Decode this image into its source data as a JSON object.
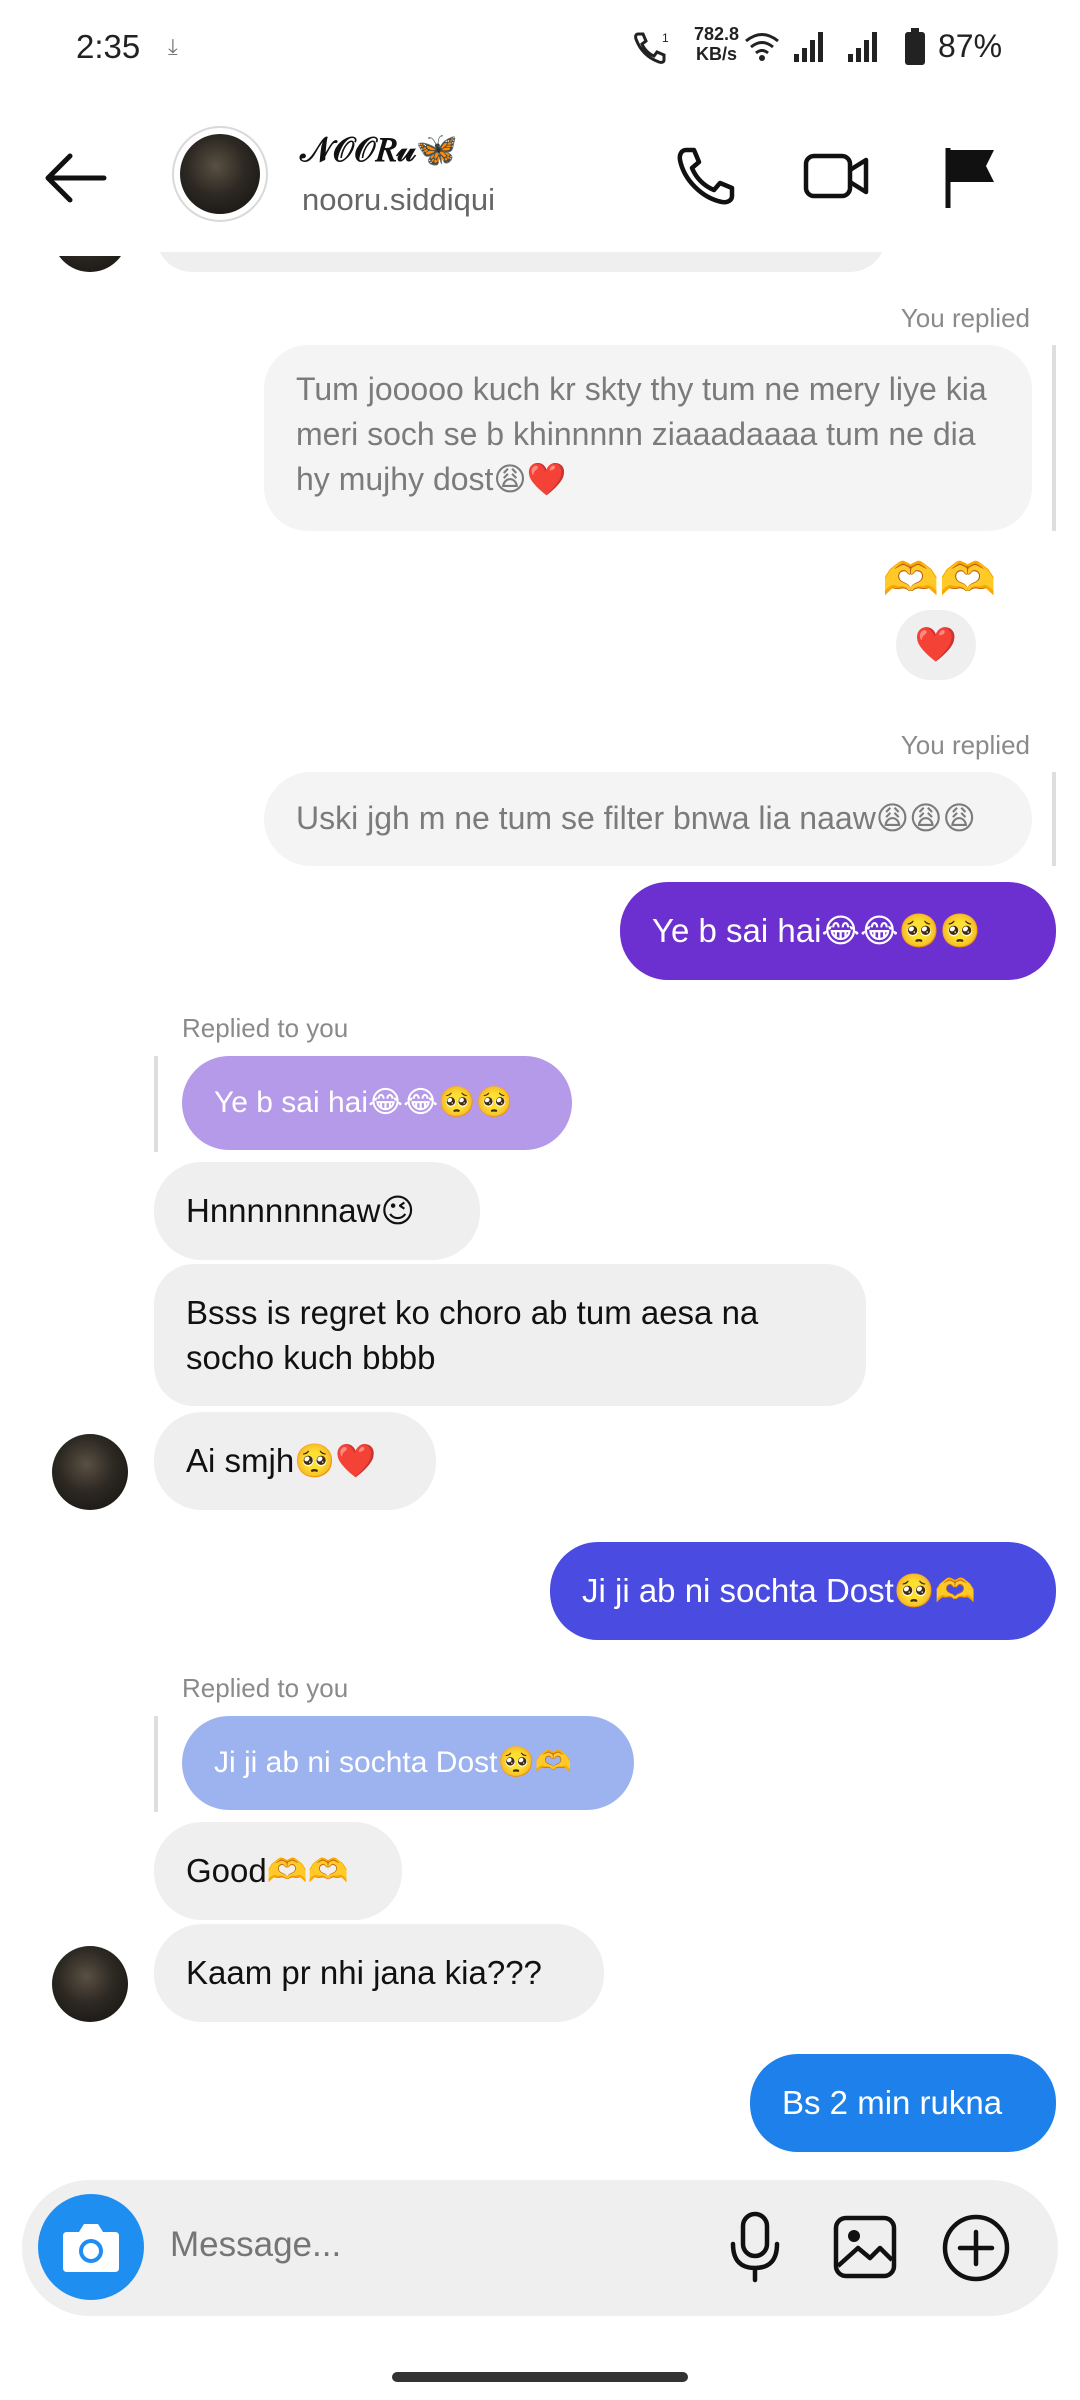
{
  "status_bar": {
    "time": "2:35",
    "download_icon": "download-icon",
    "speed_value": "782.8",
    "speed_unit": "KB/s",
    "battery": "87%"
  },
  "header": {
    "display_name": "𝒩𝒪𝒪𝑅𝓊",
    "display_name_emoji": "🦋",
    "username": "nooru.siddiqui",
    "icons": [
      "back-arrow-icon",
      "phone-icon",
      "video-camera-icon",
      "flag-icon"
    ]
  },
  "messages": {
    "you_replied_1": "You replied",
    "quoted_1": "Tum jooooo kuch kr skty thy tum ne mery liye kia meri soch se b khinnnnn ziaaadaaaa tum ne dia hy mujhy dost😩❤️",
    "hearts_emoji": "🫶🫶",
    "reaction_heart": "❤️",
    "you_replied_2": "You replied",
    "quoted_2": "Uski jgh m ne tum se filter bnwa lia naaw😩😩😩",
    "sent_1": "Ye b sai hai😂😂🥺🥺",
    "replied_to_you_1": "Replied to you",
    "quoted_3": "Ye b sai hai😂😂🥺🥺",
    "recv_1": "Hnnnnnnnaw😉",
    "recv_2": "Bsss is regret ko choro ab tum aesa na socho kuch bbbb",
    "recv_3": "Ai smjh🥺❤️",
    "sent_2": "Ji ji ab ni sochta Dost🥺🫶",
    "replied_to_you_2": "Replied to you",
    "quoted_4": "Ji ji ab ni sochta Dost🥺🫶",
    "recv_4": "Good🫶🫶",
    "recv_5": "Kaam pr nhi jana kia???",
    "sent_3": "Bs 2 min rukna"
  },
  "composer": {
    "placeholder": "Message...",
    "icons": [
      "camera-icon",
      "microphone-icon",
      "gallery-icon",
      "add-icon"
    ]
  },
  "colors": {
    "sent_purple": "#6c2fd0",
    "sent_indigo": "#4a4be0",
    "sent_blue": "#1e80ea",
    "camera_blue": "#1f8ef1",
    "incoming_gray": "#efefef"
  }
}
